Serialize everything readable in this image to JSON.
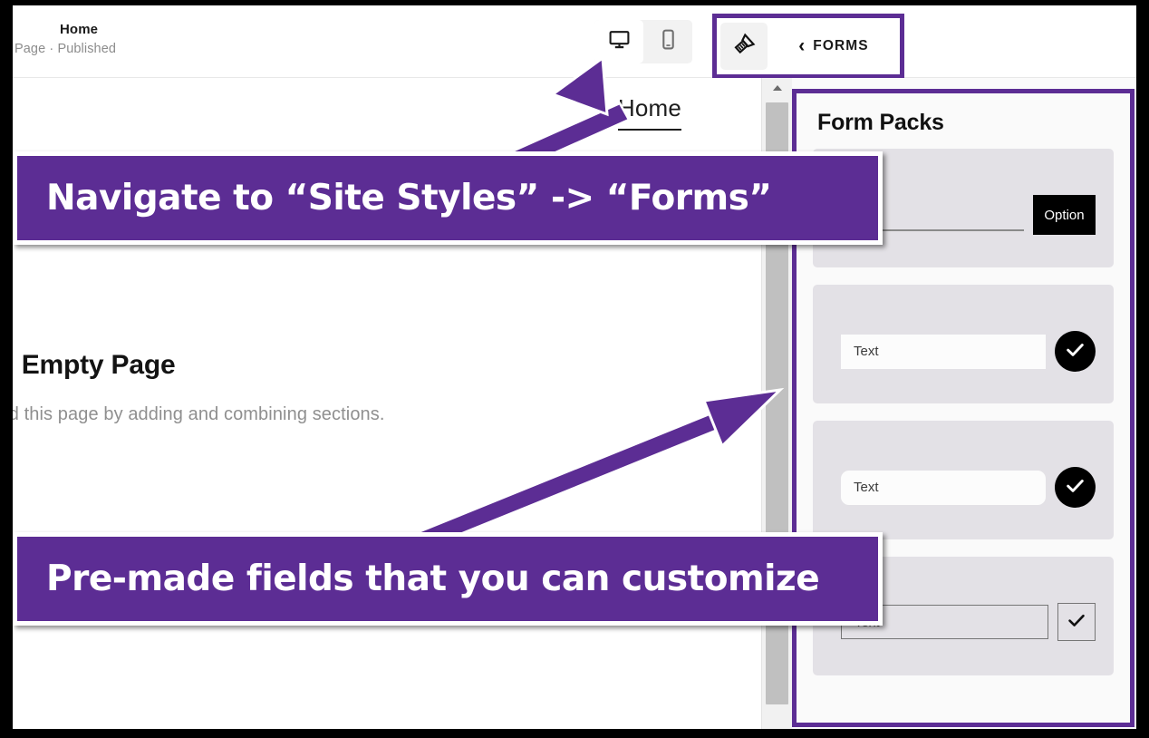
{
  "window": {
    "accent_purple": "#5C2D94",
    "panel_card_bg": "#e3e1e6"
  },
  "topbar": {
    "page_title": "Home",
    "page_status": "Page · Published",
    "device_desktop_icon": "desktop-monitor-icon",
    "device_mobile_icon": "mobile-phone-icon",
    "site_styles_icon": "paintbrush-icon",
    "back_chevron": "‹",
    "back_label": "FORMS"
  },
  "canvas": {
    "nav_item": "Home",
    "hero_headline": "An Empty Page",
    "hero_subline": "Build this page by adding and combining sections.",
    "scroll_up_icon": "scroll-up-arrow-icon"
  },
  "panel": {
    "title": "Form Packs",
    "packs": [
      {
        "field_value": "",
        "field_style": "underline",
        "action_type": "button",
        "action_label": "Option"
      },
      {
        "field_value": "Text",
        "field_style": "square",
        "action_type": "round-check",
        "action_label": "✓"
      },
      {
        "field_value": "Text",
        "field_style": "rounded",
        "action_type": "round-check",
        "action_label": "✓"
      },
      {
        "field_value": "Text",
        "field_style": "outline",
        "action_type": "square-check",
        "action_label": "✓"
      }
    ]
  },
  "annotations": [
    {
      "text": "Navigate to “Site Styles” -> “Forms”"
    },
    {
      "text": "Pre-made fields that you can customize"
    }
  ]
}
